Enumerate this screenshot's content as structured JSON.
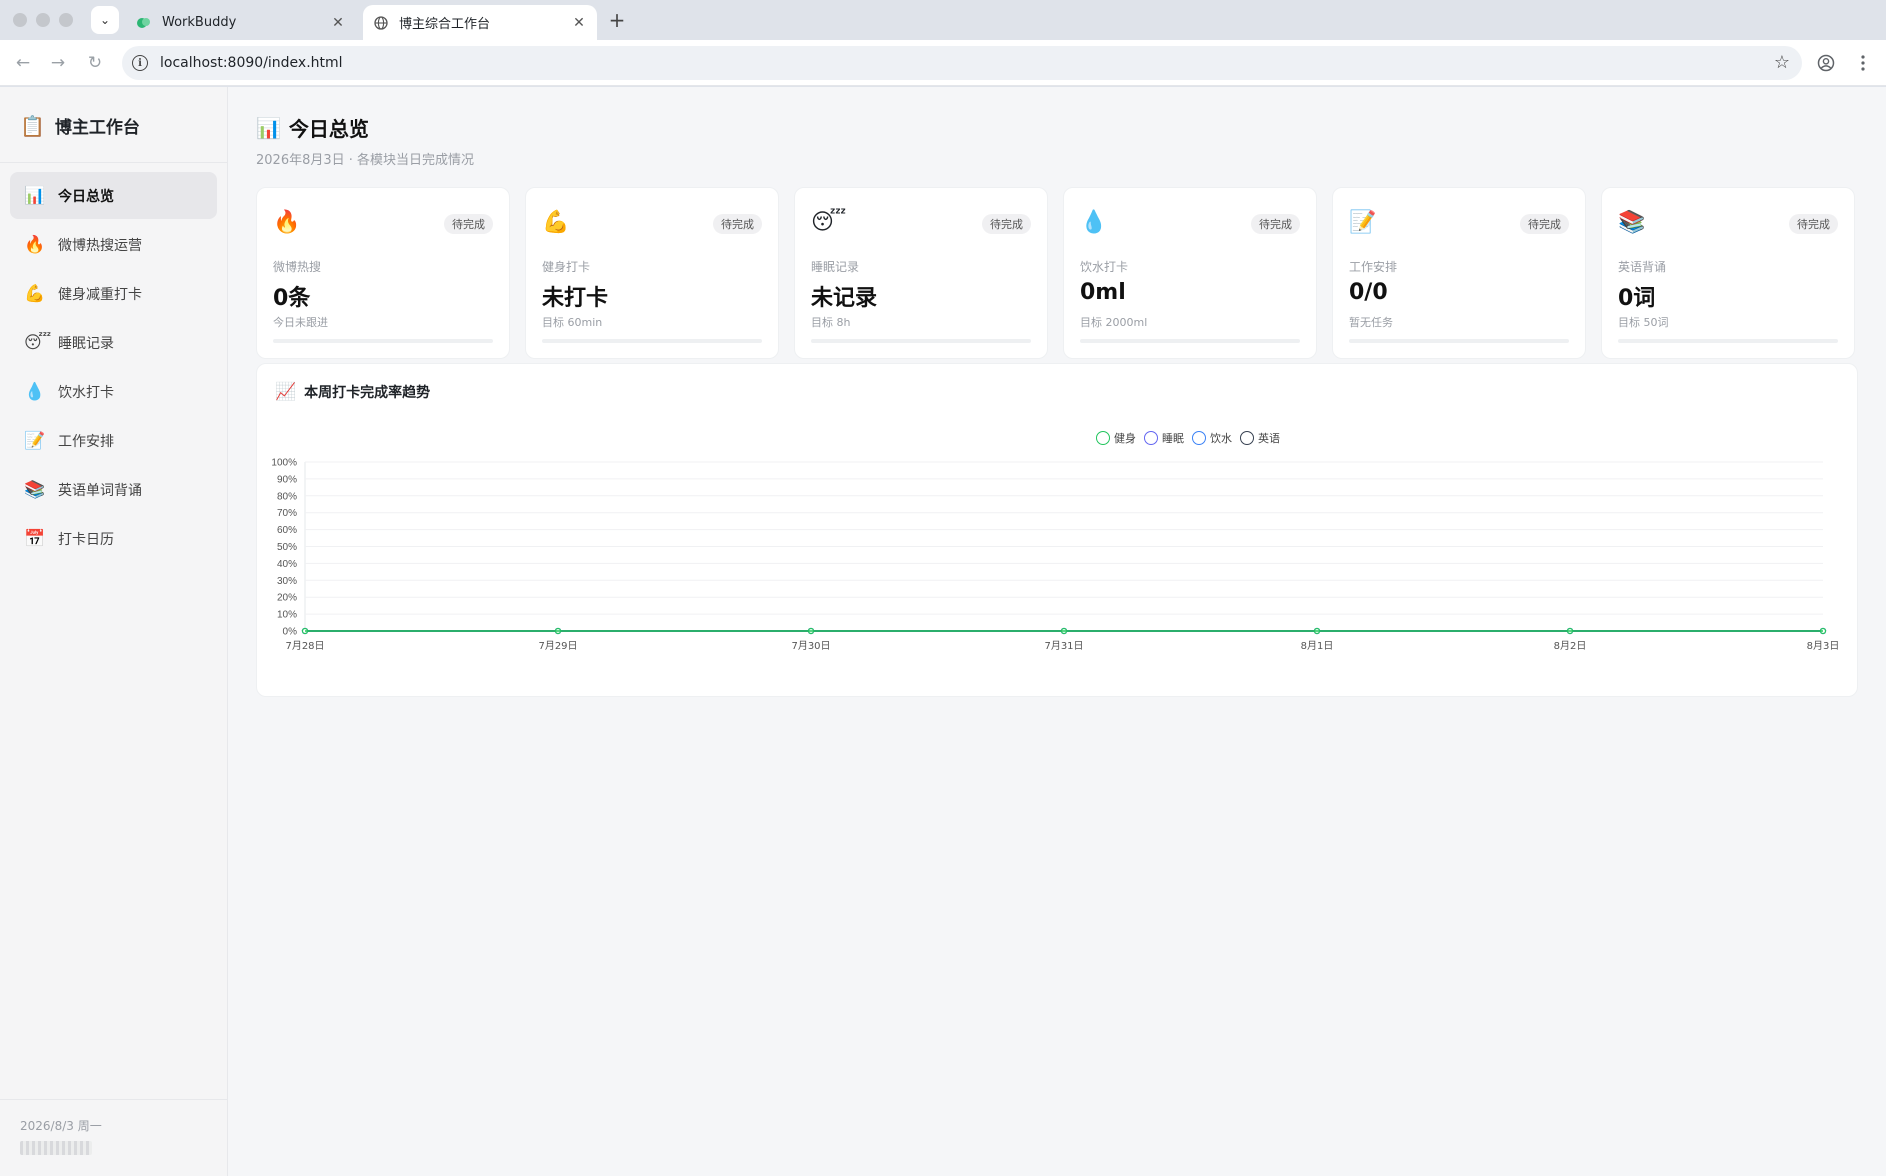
{
  "browser": {
    "tabs": [
      {
        "title": "WorkBuddy",
        "active": false
      },
      {
        "title": "博主综合工作台",
        "active": true
      }
    ],
    "url": "localhost:8090/index.html"
  },
  "sidebar": {
    "brand": "博主工作台",
    "brand_icon": "📋",
    "items": [
      {
        "icon": "📊",
        "label": "今日总览",
        "active": true
      },
      {
        "icon": "🔥",
        "label": "微博热搜运营"
      },
      {
        "icon": "💪",
        "label": "健身减重打卡"
      },
      {
        "icon": "😴",
        "label": "睡眠记录"
      },
      {
        "icon": "💧",
        "label": "饮水打卡"
      },
      {
        "icon": "📝",
        "label": "工作安排"
      },
      {
        "icon": "📚",
        "label": "英语单词背诵"
      },
      {
        "icon": "📅",
        "label": "打卡日历"
      }
    ],
    "footer_date": "2026/8/3 周一"
  },
  "header": {
    "icon": "📊",
    "title": "今日总览",
    "subtitle": "2026年8月3日 · 各模块当日完成情况"
  },
  "cards": [
    {
      "icon": "🔥",
      "badge": "待完成",
      "label": "微博热搜",
      "value": "0条",
      "note": "今日未跟进",
      "progress": 0
    },
    {
      "icon": "💪",
      "badge": "待完成",
      "label": "健身打卡",
      "value": "未打卡",
      "note": "目标 60min",
      "progress": 0
    },
    {
      "icon": "😴",
      "badge": "待完成",
      "label": "睡眠记录",
      "value": "未记录",
      "note": "目标 8h",
      "progress": 0
    },
    {
      "icon": "💧",
      "badge": "待完成",
      "label": "饮水打卡",
      "value": "0ml",
      "note": "目标 2000ml",
      "progress": 0
    },
    {
      "icon": "📝",
      "badge": "待完成",
      "label": "工作安排",
      "value": "0/0",
      "note": "暂无任务",
      "progress": 0
    },
    {
      "icon": "📚",
      "badge": "待完成",
      "label": "英语背诵",
      "value": "0词",
      "note": "目标 50词",
      "progress": 0
    }
  ],
  "chart_panel": {
    "icon": "📈",
    "title": "本周打卡完成率趋势"
  },
  "chart_data": {
    "type": "line",
    "title": "本周打卡完成率趋势",
    "x": [
      "7月28日",
      "7月29日",
      "7月30日",
      "7月31日",
      "8月1日",
      "8月2日",
      "8月3日"
    ],
    "ylim": [
      0,
      100
    ],
    "yticks": [
      "0%",
      "10%",
      "20%",
      "30%",
      "40%",
      "50%",
      "60%",
      "70%",
      "80%",
      "90%",
      "100%"
    ],
    "grid": true,
    "legend_position": "top",
    "series": [
      {
        "name": "健身",
        "color": "#22c55e",
        "values": [
          0,
          0,
          0,
          0,
          0,
          0,
          0
        ]
      },
      {
        "name": "睡眠",
        "color": "#6366f1",
        "values": [
          0,
          0,
          0,
          0,
          0,
          0,
          0
        ]
      },
      {
        "name": "饮水",
        "color": "#3b82f6",
        "values": [
          0,
          0,
          0,
          0,
          0,
          0,
          0
        ]
      },
      {
        "name": "英语",
        "color": "#374151",
        "values": [
          0,
          0,
          0,
          0,
          0,
          0,
          0
        ]
      }
    ]
  }
}
